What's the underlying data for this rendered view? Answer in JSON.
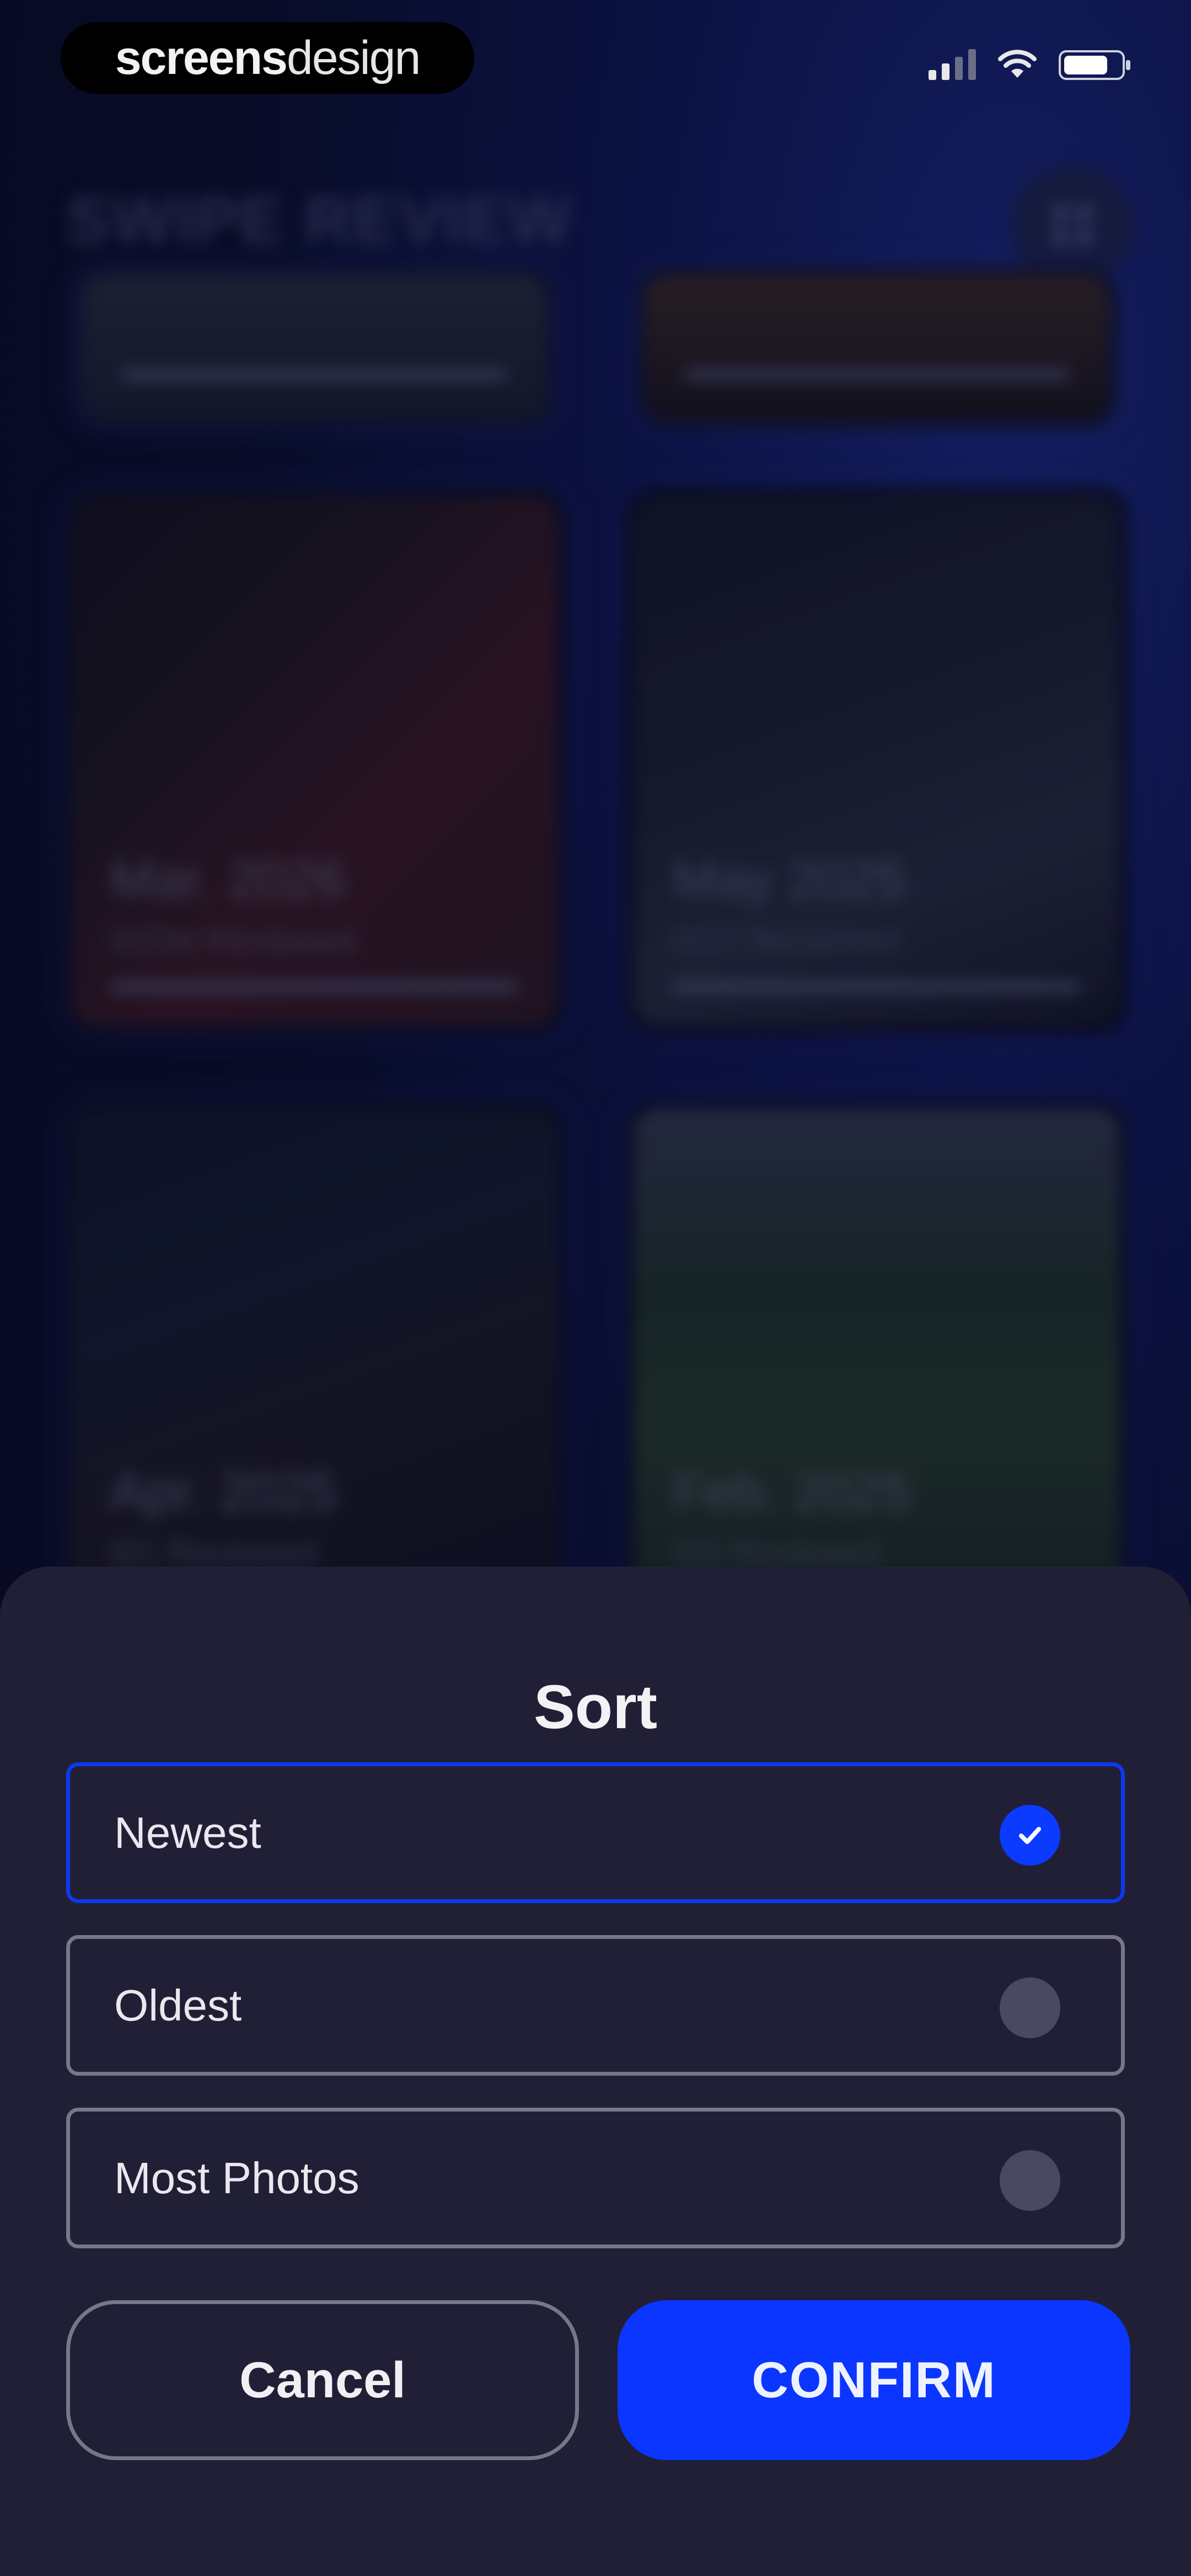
{
  "status_bar": {
    "brand_part1": "screens",
    "brand_part2": "design"
  },
  "header": {
    "title": "SWIPE REVIEW",
    "menu_icon": "grid-icon"
  },
  "cards": [
    {
      "date": "Mar. 2026",
      "subtitle": "0/234 Reviewed"
    },
    {
      "date": "May 2025",
      "subtitle": "0/17 Reviewed"
    },
    {
      "date": "Apr. 2025",
      "subtitle": "0/1 Reviewed"
    },
    {
      "date": "Feb. 2025",
      "subtitle": "0/3 Reviewed"
    }
  ],
  "sort_sheet": {
    "title": "Sort",
    "options": [
      {
        "label": "Newest",
        "selected": true
      },
      {
        "label": "Oldest",
        "selected": false
      },
      {
        "label": "Most Photos",
        "selected": false
      }
    ],
    "cancel_label": "Cancel",
    "confirm_label": "CONFIRM"
  },
  "colors": {
    "accent": "#0a36ff",
    "sheet_bg": "#211f35",
    "page_bg": "#0b0f2a"
  }
}
